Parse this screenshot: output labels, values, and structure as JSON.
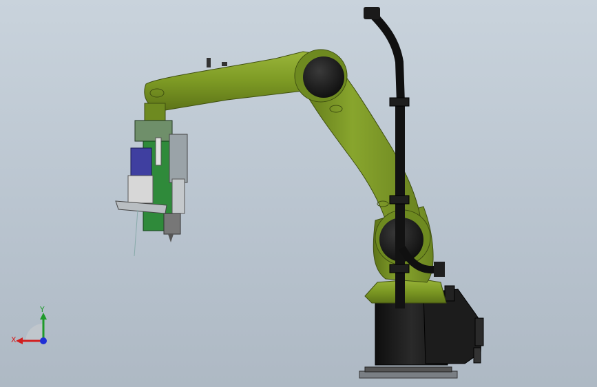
{
  "viewport": {
    "background_top": "#c9d3dc",
    "background_bottom": "#aeb9c4"
  },
  "model": {
    "description_icon": "industrial-robot-arm-with-laser-head",
    "colors": {
      "arm_green": "#7d9a24",
      "arm_green_dark": "#5d7418",
      "base_black": "#1b1b1b",
      "joint_black": "#151515",
      "head_green": "#2f8a3a",
      "head_gray": "#9aa3a8"
    }
  },
  "triad": {
    "x_label": "X",
    "y_label": "Y",
    "x_color": "#d21f1f",
    "y_color": "#1e9a2a",
    "z_color": "#1f2fd6"
  }
}
